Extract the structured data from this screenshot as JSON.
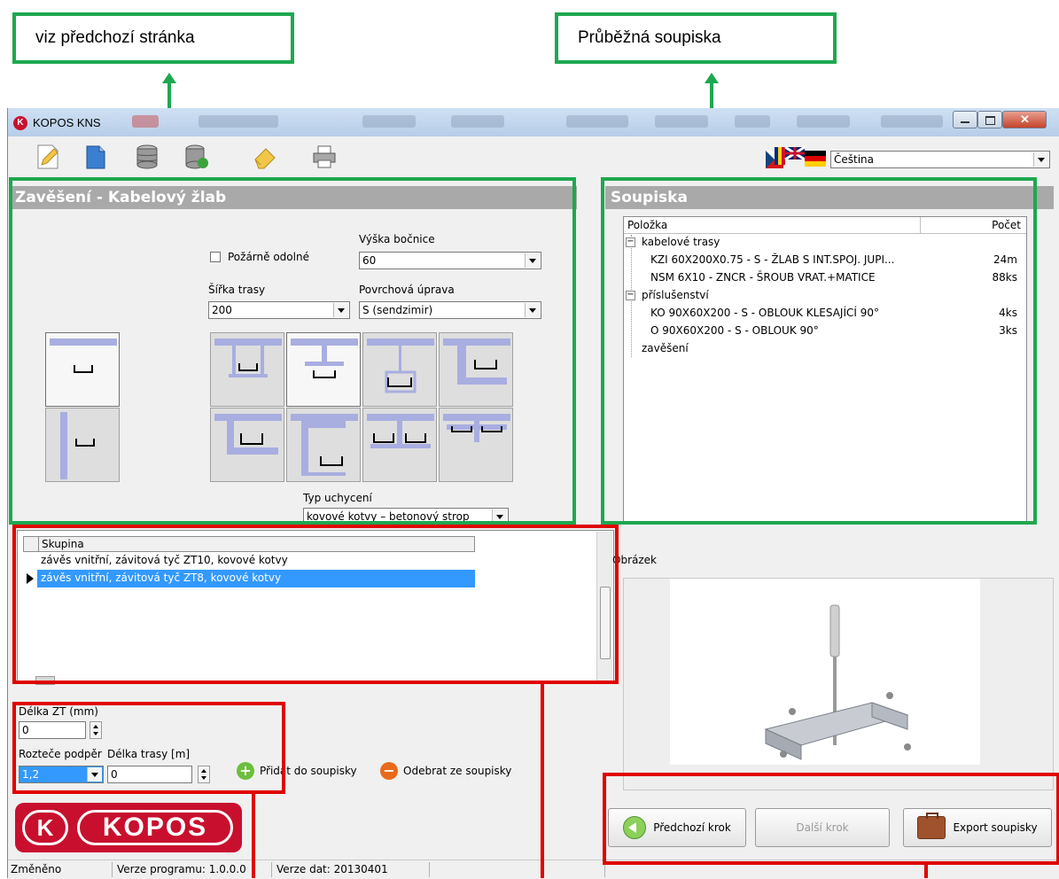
{
  "callouts": {
    "left": "viz předchozí stránka",
    "right": "Průběžná soupiska"
  },
  "window": {
    "title": "KOPOS KNS",
    "app_icon_letter": "K"
  },
  "toolbar": {
    "icons": [
      "edit-icon",
      "new-document-icon",
      "database-icon",
      "database-update-icon",
      "eraser-icon",
      "printer-icon"
    ]
  },
  "language": {
    "selected": "Čeština"
  },
  "left_panel": {
    "header": "Zavěšení - Kabelový žlab",
    "fire_resistant_label": "Požárně odolné",
    "side_height_label": "Výška bočnice",
    "side_height_value": "60",
    "width_label": "Šířka trasy",
    "width_value": "200",
    "surface_label": "Povrchová úprava",
    "surface_value": "S (sendzimir)",
    "mount_type_label": "Typ uchycení",
    "mount_type_value": "kovové kotvy – betonový strop"
  },
  "groups_grid": {
    "column": "Skupina",
    "rows": [
      "závěs vnitřní, závitová tyč ZT10, kovové kotvy",
      "závěs vnitřní, závitová tyč ZT8, kovové kotvy"
    ],
    "selected_index": 1
  },
  "params": {
    "rod_length_label": "Délka ZT (mm)",
    "rod_length_value": "0",
    "support_spacing_label": "Rozteče podpěr",
    "support_spacing_value": "1,2",
    "route_length_label": "Délka trasy [m]",
    "route_length_value": "0",
    "add_label": "Přidat do soupisky",
    "remove_label": "Odebrat ze soupisky"
  },
  "logo": {
    "letter": "K",
    "text": "KOPOS"
  },
  "right_panel": {
    "header": "Soupiska",
    "col_item": "Položka",
    "col_count": "Počet",
    "tree": [
      {
        "label": "kabelové trasy",
        "level": 0,
        "expander": "−",
        "count": ""
      },
      {
        "label": "KZI 60X200X0.75 - S - ŽLAB S INT.SPOJ. JUPI...",
        "level": 1,
        "expander": "",
        "count": "24m"
      },
      {
        "label": "NSM 6X10 - ZNCR - ŠROUB VRAT.+MATICE",
        "level": 1,
        "expander": "",
        "count": "88ks"
      },
      {
        "label": "příslušenství",
        "level": 0,
        "expander": "−",
        "count": ""
      },
      {
        "label": "KO 90X60X200 - S - OBLOUK KLESAJÍCÍ 90°",
        "level": 1,
        "expander": "",
        "count": "4ks"
      },
      {
        "label": "O 90X60X200 - S - OBLOUK 90°",
        "level": 1,
        "expander": "",
        "count": "3ks"
      },
      {
        "label": "zavěšení",
        "level": 0,
        "expander": "",
        "count": ""
      }
    ],
    "image_label": "Obrázek"
  },
  "nav": {
    "prev": "Předchozí krok",
    "next": "Další krok",
    "export": "Export soupisky"
  },
  "status": {
    "state": "Změněno",
    "program_version": "Verze programu: 1.0.0.0",
    "data_version": "Verze dat: 20130401"
  },
  "colors": {
    "callout_green": "#1ea84f",
    "highlight_red": "#e00000",
    "brand_red": "#c8102e",
    "selection_blue": "#3399ff"
  }
}
